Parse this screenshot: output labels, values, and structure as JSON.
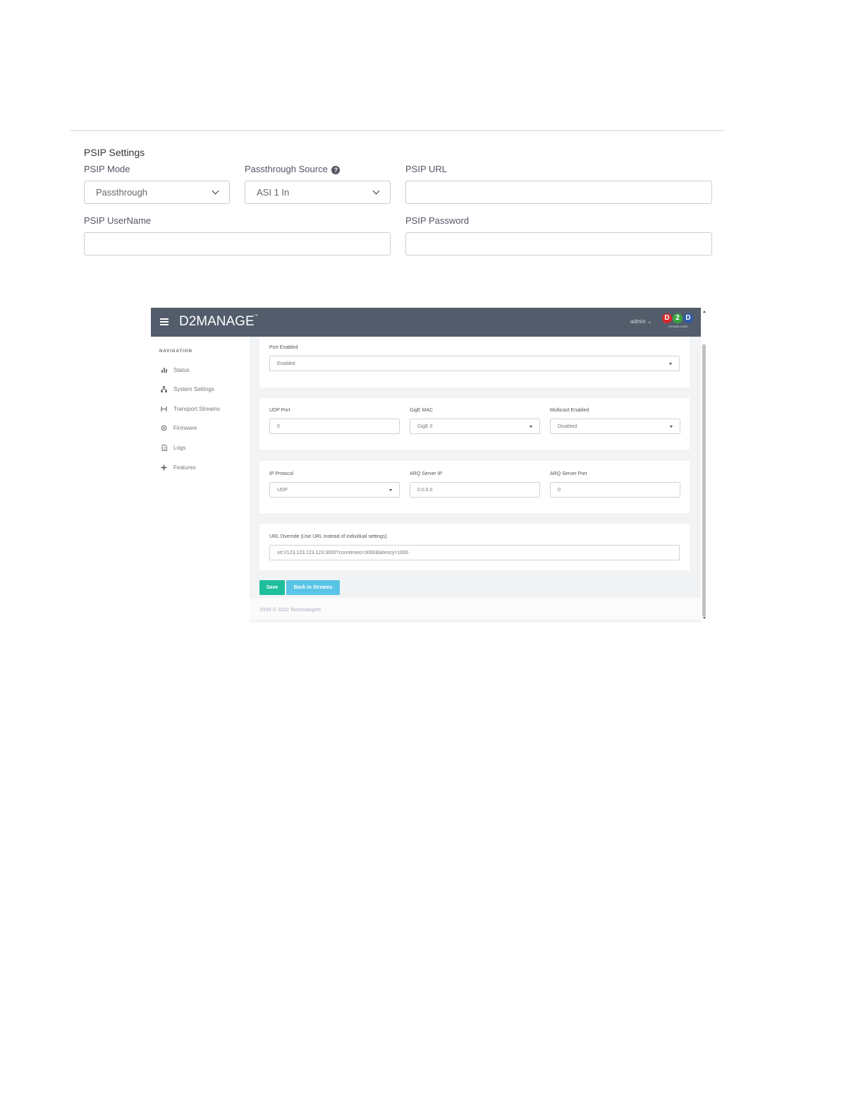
{
  "psip": {
    "title": "PSIP Settings",
    "mode_label": "PSIP Mode",
    "mode_value": "Passthrough",
    "source_label": "Passthrough Source",
    "source_value": "ASI 1 In",
    "url_label": "PSIP URL",
    "url_value": "",
    "username_label": "PSIP UserName",
    "username_value": "",
    "password_label": "PSIP Password",
    "password_value": ""
  },
  "app": {
    "brand": "D2MANAGE",
    "brand_tm": "™",
    "user": "admin ⌄",
    "logo_letters": [
      "D",
      "2",
      "D"
    ],
    "logo_colors": [
      "#d9262b",
      "#3aa641",
      "#2e5aa8"
    ],
    "logo_sub": "TECHNOLOGIES"
  },
  "nav": {
    "heading": "NAVIGATION",
    "items": [
      {
        "label": "Status",
        "icon": "bar-chart-icon"
      },
      {
        "label": "System Settings",
        "icon": "sitemap-icon"
      },
      {
        "label": "Transport Streams",
        "icon": "stream-icon"
      },
      {
        "label": "Firmware",
        "icon": "gear-icon"
      },
      {
        "label": "Logs",
        "icon": "document-icon"
      },
      {
        "label": "Features",
        "icon": "plus-icon"
      }
    ]
  },
  "form": {
    "port_enabled_label": "Port Enabled",
    "port_enabled_value": "Enabled",
    "udp_port_label": "UDP Port",
    "udp_port_value": "0",
    "gige_mac_label": "GigE MAC",
    "gige_mac_value": "GigE 0",
    "multicast_label": "Multicast Enabled",
    "multicast_value": "Disabled",
    "ip_protocol_label": "IP Protocol",
    "ip_protocol_value": "UDP",
    "arq_ip_label": "ARQ Server IP",
    "arq_ip_value": "0.0.0.0",
    "arq_port_label": "ARQ Server Port",
    "arq_port_value": "0",
    "url_override_label": "URL Override (Use URL instead of individual settings)",
    "url_override_value": "srt://123.123.123.123:3000?conntimeo=3000&latency=1600"
  },
  "buttons": {
    "save": "Save",
    "back": "Back to Streams"
  },
  "footer": "2020 © D2D Technologies",
  "colors": {
    "topbar": "#525c6b",
    "save": "#1dbf9b",
    "back": "#5ac4e6"
  }
}
